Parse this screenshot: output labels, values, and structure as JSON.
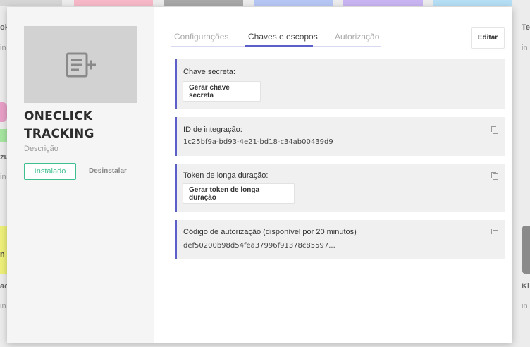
{
  "background": {
    "edge_texts": [
      "ok",
      "in",
      "zu",
      "in",
      "n",
      "ac",
      "in",
      "Te",
      "in",
      "Ki",
      "in"
    ]
  },
  "app": {
    "image_icon": "add-document-icon",
    "title": "ONECLICK TRACKING",
    "description": "Descrição",
    "installed_label": "Instalado",
    "uninstall_label": "Desinstalar"
  },
  "tabs": [
    {
      "label": "Configurações",
      "active": false
    },
    {
      "label": "Chaves e escopos",
      "active": true
    },
    {
      "label": "Autorização",
      "active": false
    }
  ],
  "edit_label": "Editar",
  "cards": {
    "secret_key": {
      "label": "Chave secreta:",
      "button_label": "Gerar chave secreta"
    },
    "integration_id": {
      "label": "ID de integração:",
      "value": "1c25bf9a-bd93-4e21-bd18-c34ab00439d9",
      "copy_icon": "copy-icon"
    },
    "long_token": {
      "label": "Token de longa duração:",
      "button_label": "Gerar token de longa duração",
      "copy_icon": "copy-icon"
    },
    "auth_code": {
      "label": "Código de autorização (disponível por 20 minutos)",
      "value": "def50200b98d54fea37996f91378c85597...",
      "copy_icon": "copy-icon"
    }
  },
  "colors": {
    "accent": "#5b5fc7",
    "installed_green": "#3fbf8f",
    "card_bg": "#f0f0f0",
    "image_placeholder": "#d2d2d2"
  }
}
